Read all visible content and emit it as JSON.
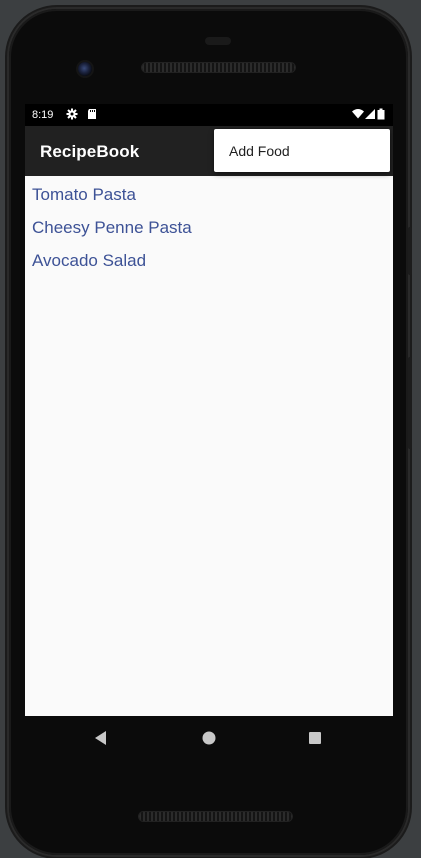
{
  "status_bar": {
    "time": "8:19",
    "left_icons": [
      "gear-icon",
      "sd-card-icon"
    ],
    "right_icons": [
      "wifi-icon",
      "cell-signal-icon",
      "battery-icon"
    ]
  },
  "app_bar": {
    "title": "RecipeBook"
  },
  "overflow_menu": {
    "items": [
      {
        "label": "Add Food"
      }
    ]
  },
  "recipes": [
    {
      "name": "Tomato Pasta"
    },
    {
      "name": "Cheesy Penne Pasta"
    },
    {
      "name": "Avocado Salad"
    }
  ],
  "nav_bar": {
    "buttons": [
      "back-icon",
      "home-icon",
      "recents-icon"
    ]
  },
  "colors": {
    "app_bar": "#212121",
    "list_text": "#3d5296",
    "content_bg": "#fafafa",
    "menu_bg": "#ffffff"
  }
}
